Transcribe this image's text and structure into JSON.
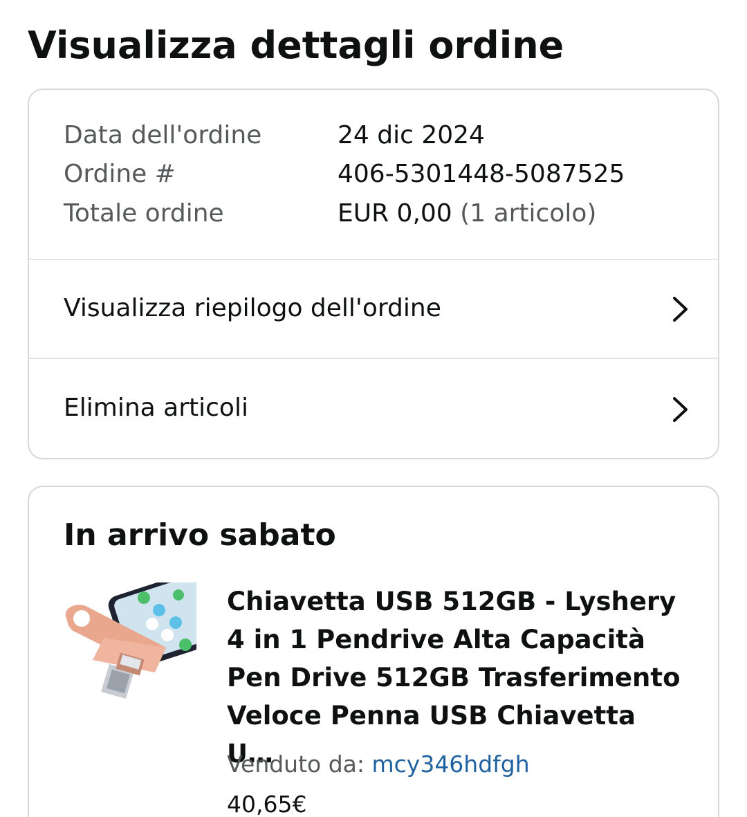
{
  "page": {
    "title": "Visualizza dettagli ordine"
  },
  "order_info": {
    "date_label": "Data dell'ordine",
    "date_value": "24 dic 2024",
    "number_label": "Ordine #",
    "number_value": "406-5301448-5087525",
    "total_label": "Totale ordine",
    "total_value": "EUR 0,00",
    "total_items": "(1 articolo)"
  },
  "actions": {
    "summary_label": "Visualizza riepilogo dell'ordine",
    "delete_label": "Elimina articoli",
    "chevron_icon": "chevron-right-icon"
  },
  "delivery": {
    "status_title": "In arrivo sabato",
    "product": {
      "image_icon": "usb-flash-drive-image",
      "title": "Chiavetta USB 512GB - Lyshery 4 in 1 Pendrive Alta Capacità Pen Drive 512GB Trasferimento Veloce Penna USB Chiavetta U…",
      "sold_by_label": "Venduto da:",
      "seller": "mcy346hdfgh",
      "price": "40,65€"
    }
  },
  "colors": {
    "text": "#0f1111",
    "muted_text": "#565959",
    "link": "#2162a1",
    "border": "#d5d9d9",
    "product_color": "#e9a78d"
  }
}
